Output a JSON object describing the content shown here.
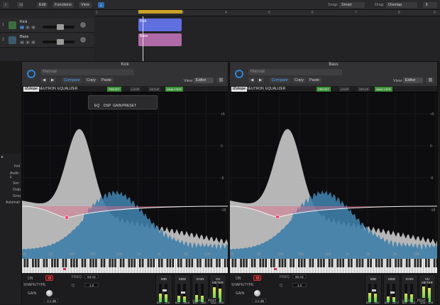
{
  "toolbar": {
    "edit": "Edit",
    "functions": "Functions",
    "view": "View",
    "snap_label": "Snap:",
    "snap_value": "Smart",
    "drag_label": "Drag:",
    "drag_value": "Overlap"
  },
  "ruler": [
    "1",
    "2",
    "3",
    "4",
    "5",
    "6",
    "7",
    "8",
    "9"
  ],
  "tracks": [
    {
      "num": "1",
      "name": "Kick"
    },
    {
      "num": "2",
      "name": "Bass"
    }
  ],
  "track_buttons": {
    "mute": "M",
    "solo": "S",
    "rec": "R"
  },
  "regions": [
    {
      "name": "Kick",
      "color": "#5f6fe0"
    },
    {
      "name": "Bass",
      "color": "#e0a0d8"
    }
  ],
  "inspector_labels": [
    "Inst",
    "Audio F",
    "Sen",
    "Outp",
    "Grou",
    "Automati"
  ],
  "plugins": [
    {
      "title": "Kick",
      "preset": "Manual",
      "compare": "Compare",
      "copy": "Copy",
      "paste": "Paste",
      "view_label": "View:",
      "view_value": "Editor",
      "brand": "iZotope",
      "product": "NEUTRON",
      "eq_name": "EQUALIZER",
      "preset_btn": "PRESET",
      "loop_btn": "LOOP",
      "setup_btn": "SETUP",
      "analyzer_btn": "ANALYZER",
      "subbar": [
        "EQ",
        "DSP",
        "GAIN",
        "PRESET"
      ],
      "freq_labels": [
        "20",
        "50",
        "100",
        "200",
        "500",
        "1k",
        "2k",
        "5k",
        "10k"
      ],
      "db_labels": [
        "+6",
        "0",
        "-6",
        "-18"
      ],
      "controls": {
        "on": "ON",
        "shape": "SHAPE/TYPE",
        "gain": "GAIN",
        "gain_val": "-4.2 dB",
        "freq": "FREQ",
        "freq_val": "53 Hz",
        "q": "Q",
        "q_val": "1.0"
      },
      "mid": "MID",
      "side": "SIDE",
      "gain_h": "GAIN",
      "vu": "VU METER",
      "mid_vals": [
        "0.0",
        "-2.0"
      ],
      "side_vals": [
        "0.0",
        "-20.0"
      ],
      "gain_vals": [
        "0.0",
        "-0.0"
      ],
      "vu_vals": [
        "-0.0",
        "-0.0"
      ],
      "listen": "LISTEN",
      "post": "POST",
      "meters": {
        "mid": 0.45,
        "side": 0.35,
        "gain": 0.4,
        "vu": 0.8
      }
    },
    {
      "title": "Bass",
      "preset": "Manual",
      "compare": "Compare",
      "copy": "Copy",
      "paste": "Paste",
      "view_label": "View:",
      "view_value": "Editor",
      "brand": "iZotope",
      "product": "NEUTRON",
      "eq_name": "EQUALIZER",
      "preset_btn": "PRESET",
      "loop_btn": "LOOP",
      "setup_btn": "SETUP",
      "analyzer_btn": "ANALYZER",
      "subbar": [],
      "freq_labels": [
        "20",
        "50",
        "100",
        "200",
        "500",
        "1k",
        "2k",
        "5k",
        "10k"
      ],
      "db_labels": [
        "+6",
        "0",
        "-6",
        "-18"
      ],
      "controls": {
        "on": "ON",
        "shape": "SHAPE/TYPE",
        "gain": "GAIN",
        "gain_val": "-3.3 dB",
        "freq": "FREQ",
        "freq_val": "80 Hz",
        "q": "Q",
        "q_val": "1.0"
      },
      "mid": "MID",
      "side": "SIDE",
      "gain_h": "GAIN",
      "vu": "VU METER",
      "mid_vals": [
        "0.0",
        "-3.0"
      ],
      "side_vals": [
        "0.0",
        "-17.7"
      ],
      "gain_vals": [
        "0.0",
        "-0.3"
      ],
      "vu_vals": [
        "-0.5",
        "-2.9"
      ],
      "listen": "LISTEN",
      "post": "POST",
      "meters": {
        "mid": 0.5,
        "side": 0.3,
        "gain": 0.45,
        "vu": 0.85
      }
    }
  ],
  "colors": {
    "accent": "#2e86d6",
    "green": "#3a8f36",
    "eq_fill": "#e06b8a",
    "spectrum": "#3f7ea8",
    "overlay": "#d5d5d5"
  }
}
